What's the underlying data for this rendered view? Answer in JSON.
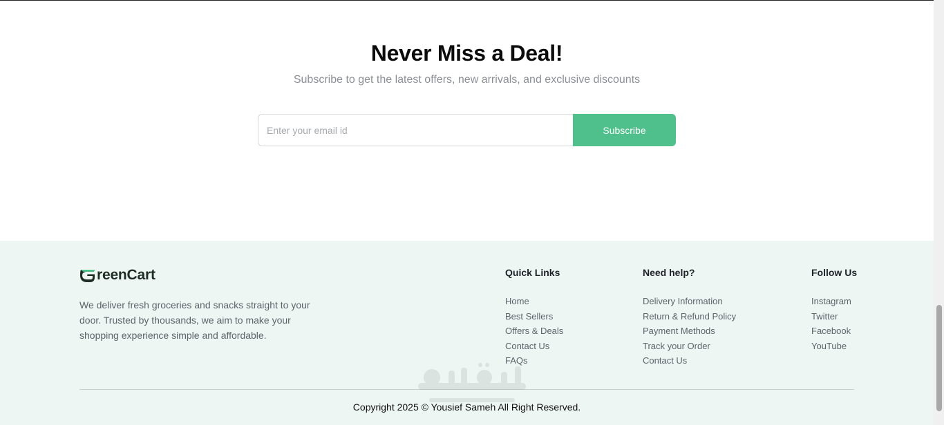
{
  "newsletter": {
    "title": "Never Miss a Deal!",
    "subtitle": "Subscribe to get the latest offers, new arrivals, and exclusive discounts",
    "email_placeholder": "Enter your email id",
    "email_value": "",
    "subscribe_label": "Subscribe"
  },
  "footer": {
    "logo_text": "reenCart",
    "description": "We deliver fresh groceries and snacks straight to your door. Trusted by thousands, we aim to make your shopping experience simple and affordable.",
    "quick_links": {
      "heading": "Quick Links",
      "items": [
        "Home",
        "Best Sellers",
        "Offers & Deals",
        "Contact Us",
        "FAQs"
      ]
    },
    "need_help": {
      "heading": "Need help?",
      "items": [
        "Delivery Information",
        "Return & Refund Policy",
        "Payment Methods",
        "Track your Order",
        "Contact Us"
      ]
    },
    "follow_us": {
      "heading": "Follow Us",
      "items": [
        "Instagram",
        "Twitter",
        "Facebook",
        "YouTube"
      ]
    },
    "copyright": "Copyright 2025 © Yousief Sameh All Right Reserved."
  },
  "colors": {
    "accent": "#4fbf8b",
    "footer_bg": "#edf6f2",
    "text_muted": "#5d6369"
  },
  "icons": {
    "logo": "greencart-logo-icon",
    "watermark": "mostaql-watermark"
  }
}
